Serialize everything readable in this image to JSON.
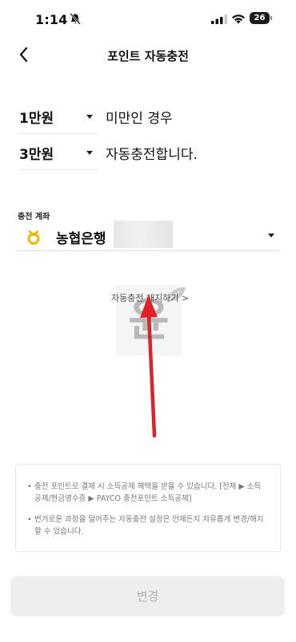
{
  "status_bar": {
    "time": "1:14",
    "battery": "26"
  },
  "header": {
    "title": "포인트 자동충전",
    "back_icon": "chevron-left-icon"
  },
  "settings": {
    "threshold": {
      "value": "1만원",
      "suffix": "미만인 경우"
    },
    "charge": {
      "value": "3만원",
      "suffix": "자동충전합니다."
    }
  },
  "account": {
    "label": "충전 계좌",
    "bank_name": "농협은행",
    "bank_icon": "nonghyup-logo-icon"
  },
  "cancel_link": "자동충전 해지하기 >",
  "watermark": {
    "glyph": "윤"
  },
  "notices": [
    {
      "bullet": "•",
      "text": "충전 포인트로 결제 시 소득공제 혜택을 받을 수 있습니다. [전체 ▶ 소득공제/현금영수증 ▶ PAYCO 충전포인트 소득공제]"
    },
    {
      "bullet": "•",
      "text": "번거로운 과정을 덜어주는 자동충전 설정은 언제든지 자유롭게 변경/해지할 수 있습니다."
    }
  ],
  "submit_button": {
    "label": "변경",
    "state": "disabled"
  },
  "colors": {
    "annotation_arrow": "#e0202a",
    "bank_logo": "#f4b400",
    "button_bg": "#eeeef0",
    "button_text": "#b3b3b6"
  }
}
